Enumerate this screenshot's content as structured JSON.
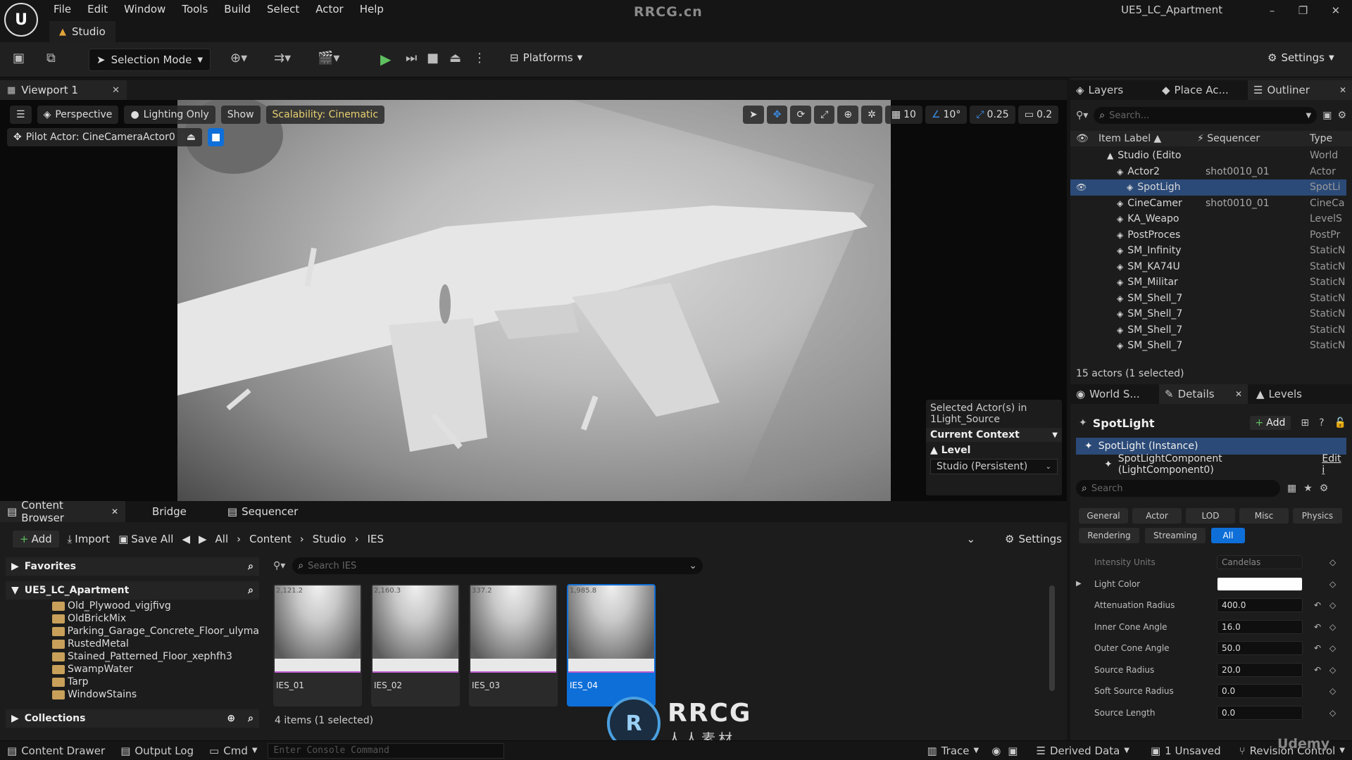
{
  "app": {
    "watermark": "RRCG.cn",
    "project": "UE5_LC_Apartment",
    "logo": "U"
  },
  "menu": [
    "File",
    "Edit",
    "Window",
    "Tools",
    "Build",
    "Select",
    "Actor",
    "Help"
  ],
  "level_tab": "Studio",
  "toolbar": {
    "selection_mode": "Selection Mode",
    "platforms": "Platforms",
    "settings": "Settings"
  },
  "viewport": {
    "tab": "Viewport 1",
    "perspective": "Perspective",
    "lighting": "Lighting Only",
    "show": "Show",
    "scalability": "Scalability: Cinematic",
    "pilot": "Pilot Actor: CineCameraActor0",
    "grid": "10",
    "angle": "10°",
    "scale": "0.25",
    "cam_speed": "0.2"
  },
  "selected_info": {
    "line1": "Selected Actor(s) in",
    "line2": "1Light_Source",
    "context": "Current Context",
    "level_label": "Level",
    "level_value": "Studio (Persistent)"
  },
  "right_tabs": {
    "layers": "Layers",
    "place": "Place Ac...",
    "outliner": "Outliner"
  },
  "outliner": {
    "search_placeholder": "Search...",
    "col_label": "Item Label",
    "col_seq": "Sequencer",
    "col_type": "Type",
    "rows": [
      {
        "label": "Studio (Edito",
        "seq": "",
        "type": "World",
        "indent": 0
      },
      {
        "label": "Actor2",
        "seq": "shot0010_01",
        "type": "Actor",
        "indent": 1
      },
      {
        "label": "SpotLigh",
        "seq": "",
        "type": "SpotLi",
        "indent": 2
      },
      {
        "label": "CineCamer",
        "seq": "shot0010_01",
        "type": "CineCa",
        "indent": 1
      },
      {
        "label": "KA_Weapo",
        "seq": "",
        "type": "LevelS",
        "indent": 1
      },
      {
        "label": "PostProces",
        "seq": "",
        "type": "PostPr",
        "indent": 1
      },
      {
        "label": "SM_Infinity",
        "seq": "",
        "type": "StaticN",
        "indent": 1
      },
      {
        "label": "SM_KA74U",
        "seq": "",
        "type": "StaticN",
        "indent": 1
      },
      {
        "label": "SM_Militar",
        "seq": "",
        "type": "StaticN",
        "indent": 1
      },
      {
        "label": "SM_Shell_7",
        "seq": "",
        "type": "StaticN",
        "indent": 1
      },
      {
        "label": "SM_Shell_7",
        "seq": "",
        "type": "StaticN",
        "indent": 1
      },
      {
        "label": "SM_Shell_7",
        "seq": "",
        "type": "StaticN",
        "indent": 1
      },
      {
        "label": "SM_Shell_7",
        "seq": "",
        "type": "StaticN",
        "indent": 1
      }
    ],
    "count": "15 actors (1 selected)"
  },
  "lower_tabs": {
    "world": "World S...",
    "details": "Details",
    "levels": "Levels"
  },
  "details": {
    "title": "SpotLight",
    "add": "Add",
    "instance": "SpotLight (Instance)",
    "component": "SpotLightComponent (LightComponent0)",
    "edit": "Edit i",
    "search_placeholder": "Search",
    "filters": [
      "General",
      "Actor",
      "LOD",
      "Misc",
      "Physics",
      "Rendering",
      "Streaming",
      "All"
    ],
    "rows": [
      {
        "label": "Intensity Units",
        "value": "Candelas"
      },
      {
        "label": "Light Color",
        "value": ""
      },
      {
        "label": "Attenuation Radius",
        "value": "400.0"
      },
      {
        "label": "Inner Cone Angle",
        "value": "16.0"
      },
      {
        "label": "Outer Cone Angle",
        "value": "50.0"
      },
      {
        "label": "Source Radius",
        "value": "20.0"
      },
      {
        "label": "Soft Source Radius",
        "value": "0.0"
      },
      {
        "label": "Source Length",
        "value": "0.0"
      }
    ]
  },
  "content_browser": {
    "tab": "Content Browser",
    "bridge": "Bridge",
    "sequencer": "Sequencer",
    "add": "Add",
    "import": "Import",
    "save_all": "Save All",
    "settings": "Settings",
    "path": [
      "All",
      "Content",
      "Studio",
      "IES"
    ],
    "favorites": "Favorites",
    "project": "UE5_LC_Apartment",
    "collections": "Collections",
    "folders": [
      "Old_Plywood_vigjfivg",
      "OldBrickMix",
      "Parking_Garage_Concrete_Floor_ulyma",
      "RustedMetal",
      "Stained_Patterned_Floor_xephfh3",
      "SwampWater",
      "Tarp",
      "WindowStains"
    ],
    "search_placeholder": "Search IES",
    "assets": [
      {
        "name": "IES_01",
        "badge": "2,121.2"
      },
      {
        "name": "IES_02",
        "badge": "2,160.3"
      },
      {
        "name": "IES_03",
        "badge": "337.2"
      },
      {
        "name": "IES_04",
        "badge": "1,985.8"
      }
    ],
    "count": "4 items (1 selected)"
  },
  "status": {
    "drawer": "Content Drawer",
    "output": "Output Log",
    "cmd": "Cmd",
    "console_placeholder": "Enter Console Command",
    "trace": "Trace",
    "derived": "Derived Data",
    "unsaved": "1 Unsaved",
    "revision": "Revision Control",
    "udemy": "Udemy"
  },
  "rrcg": {
    "logo": "RRCG",
    "sub": "人人素材"
  },
  "colors": {
    "accent": "#0f6fd8",
    "scalability": "#e8d070",
    "selected_row": "#2b4a78"
  }
}
